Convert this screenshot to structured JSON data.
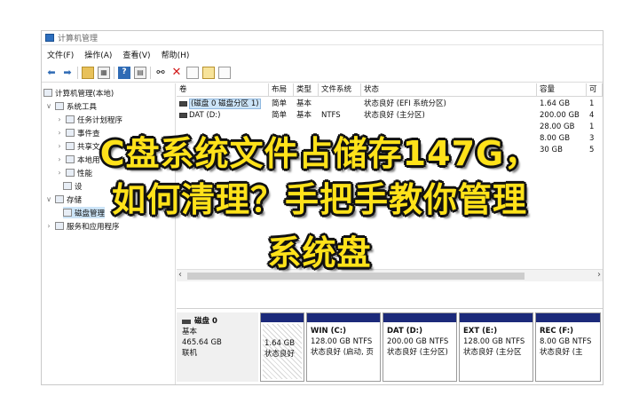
{
  "window": {
    "title": "计算机管理"
  },
  "menu": [
    "文件(F)",
    "操作(A)",
    "查看(V)",
    "帮助(H)"
  ],
  "toolbar_icons": [
    "back-arrow-icon",
    "forward-arrow-icon",
    "folder-up-icon",
    "properties-icon",
    "help-icon",
    "console-icon",
    "connect-icon",
    "delete-icon",
    "check-icon",
    "open-file-icon",
    "export-icon"
  ],
  "tree": {
    "root": "计算机管理(本地)",
    "system_tools": "系统工具",
    "task_scheduler": "任务计划程序",
    "event_viewer_partial": "事件查",
    "shared_partial": "共享文",
    "users_partial": "本地用",
    "performance": "性能",
    "device_manager_partial": "设",
    "storage_partial": "存储",
    "disk_management": "磁盘管理",
    "services": "服务和应用程序"
  },
  "columns": [
    "卷",
    "布局",
    "类型",
    "文件系统",
    "状态",
    "容量",
    "可"
  ],
  "volumes": [
    {
      "name": "(磁盘 0 磁盘分区 1)",
      "layout": "简单",
      "type": "基本",
      "fs": "",
      "status": "状态良好 (EFI 系统分区)",
      "capacity": "1.64 GB",
      "free": "1"
    },
    {
      "name": "DAT (D:)",
      "layout": "简单",
      "type": "基本",
      "fs": "NTFS",
      "status": "状态良好 (主分区)",
      "capacity": "200.00 GB",
      "free": "4"
    },
    {
      "name": "",
      "layout": "",
      "type": "",
      "fs": "",
      "status": "",
      "capacity": "28.00 GB",
      "free": "1"
    },
    {
      "name": "",
      "layout": "",
      "type": "",
      "fs": "",
      "status": "",
      "capacity": "8.00 GB",
      "free": "3"
    },
    {
      "name": "",
      "layout": "",
      "type": "",
      "fs": "",
      "status": "",
      "capacity": "30 GB",
      "free": "5"
    }
  ],
  "disk": {
    "name": "磁盘 0",
    "type": "基本",
    "size": "465.64 GB",
    "state": "联机",
    "partitions": [
      {
        "name": "",
        "size": "1.64 GB",
        "status": "状态良好"
      },
      {
        "name": "WIN (C:)",
        "size": "128.00 GB NTFS",
        "status": "状态良好 (启动, 页"
      },
      {
        "name": "DAT (D:)",
        "size": "200.00 GB NTFS",
        "status": "状态良好 (主分区)"
      },
      {
        "name": "EXT (E:)",
        "size": "128.00 GB NTFS",
        "status": "状态良好 (主分区"
      },
      {
        "name": "REC (F:)",
        "size": "8.00 GB NTFS",
        "status": "状态良好 (主"
      }
    ]
  },
  "overlay": {
    "line1": "C盘系统文件占储存147G，",
    "line2": "如何清理？手把手教你管理",
    "line3": "系统盘"
  },
  "colors": {
    "partition_bar": "#1c2a7a",
    "overlay_text": "#ffe21a",
    "selection": "#cce4f7"
  }
}
